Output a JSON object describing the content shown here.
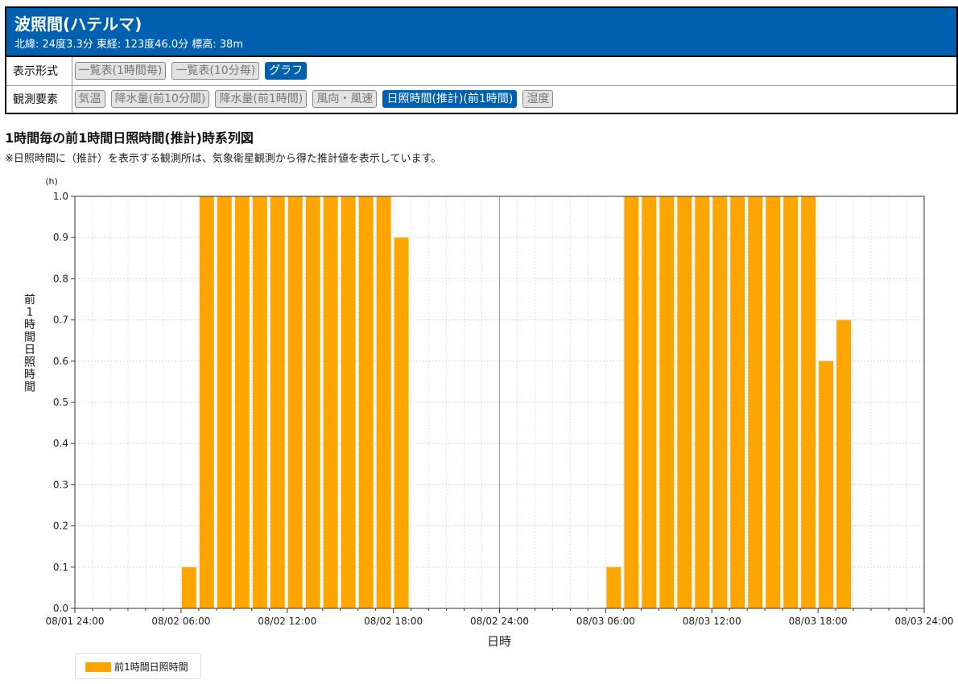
{
  "station": {
    "name": "波照間(ハテルマ)",
    "coords": "北緯: 24度3.3分 東経: 123度46.0分 標高: 38m"
  },
  "display_format": {
    "label": "表示形式",
    "buttons": [
      {
        "label": "一覧表(1時間毎)",
        "active": false
      },
      {
        "label": "一覧表(10分毎)",
        "active": false
      },
      {
        "label": "グラフ",
        "active": true
      }
    ]
  },
  "elements": {
    "label": "観測要素",
    "buttons": [
      {
        "label": "気温",
        "active": false
      },
      {
        "label": "降水量(前10分間)",
        "active": false
      },
      {
        "label": "降水量(前1時間)",
        "active": false
      },
      {
        "label": "風向・風速",
        "active": false
      },
      {
        "label": "日照時間(推計)(前1時間)",
        "active": true
      },
      {
        "label": "湿度",
        "active": false
      }
    ]
  },
  "page_title": "1時間毎の前1時間日照時間(推計)時系列図",
  "note": "※日照時間に（推計）を表示する観測所は、気象衛星観測から得た推計値を表示しています。",
  "legend": {
    "label": "前1時間日照時間"
  },
  "colors": {
    "header": "#0060b0",
    "bar": "#ffa500",
    "active_button": "#0060b0"
  },
  "chart_data": {
    "type": "bar",
    "title": "",
    "xlabel": "日時",
    "ylabel": "前1時間日照時間",
    "y_unit": "(h)",
    "ylim": [
      0.0,
      1.0
    ],
    "y_ticks": [
      "0.0",
      "0.1",
      "0.2",
      "0.3",
      "0.4",
      "0.5",
      "0.6",
      "0.7",
      "0.8",
      "0.9",
      "1.0"
    ],
    "xlim": [
      "08/02 00:00",
      "08/04 00:00"
    ],
    "x_ticks": [
      "08/01 24:00",
      "08/02 06:00",
      "08/02 12:00",
      "08/02 18:00",
      "08/02 24:00",
      "08/03 06:00",
      "08/03 12:00",
      "08/03 18:00",
      "08/03 24:00"
    ],
    "grid": true,
    "legend_position": "bottom-left",
    "series": [
      {
        "name": "前1時間日照時間",
        "color": "#ffa500",
        "points": [
          {
            "x": "08/02 07:00",
            "y": 0.1
          },
          {
            "x": "08/02 08:00",
            "y": 1.0
          },
          {
            "x": "08/02 09:00",
            "y": 1.0
          },
          {
            "x": "08/02 10:00",
            "y": 1.0
          },
          {
            "x": "08/02 11:00",
            "y": 1.0
          },
          {
            "x": "08/02 12:00",
            "y": 1.0
          },
          {
            "x": "08/02 13:00",
            "y": 1.0
          },
          {
            "x": "08/02 14:00",
            "y": 1.0
          },
          {
            "x": "08/02 15:00",
            "y": 1.0
          },
          {
            "x": "08/02 16:00",
            "y": 1.0
          },
          {
            "x": "08/02 17:00",
            "y": 1.0
          },
          {
            "x": "08/02 18:00",
            "y": 1.0
          },
          {
            "x": "08/02 19:00",
            "y": 0.9
          },
          {
            "x": "08/03 07:00",
            "y": 0.1
          },
          {
            "x": "08/03 08:00",
            "y": 1.0
          },
          {
            "x": "08/03 09:00",
            "y": 1.0
          },
          {
            "x": "08/03 10:00",
            "y": 1.0
          },
          {
            "x": "08/03 11:00",
            "y": 1.0
          },
          {
            "x": "08/03 12:00",
            "y": 1.0
          },
          {
            "x": "08/03 13:00",
            "y": 1.0
          },
          {
            "x": "08/03 14:00",
            "y": 1.0
          },
          {
            "x": "08/03 15:00",
            "y": 1.0
          },
          {
            "x": "08/03 16:00",
            "y": 1.0
          },
          {
            "x": "08/03 17:00",
            "y": 1.0
          },
          {
            "x": "08/03 18:00",
            "y": 1.0
          },
          {
            "x": "08/03 19:00",
            "y": 0.6
          },
          {
            "x": "08/03 20:00",
            "y": 0.7
          }
        ]
      }
    ]
  }
}
